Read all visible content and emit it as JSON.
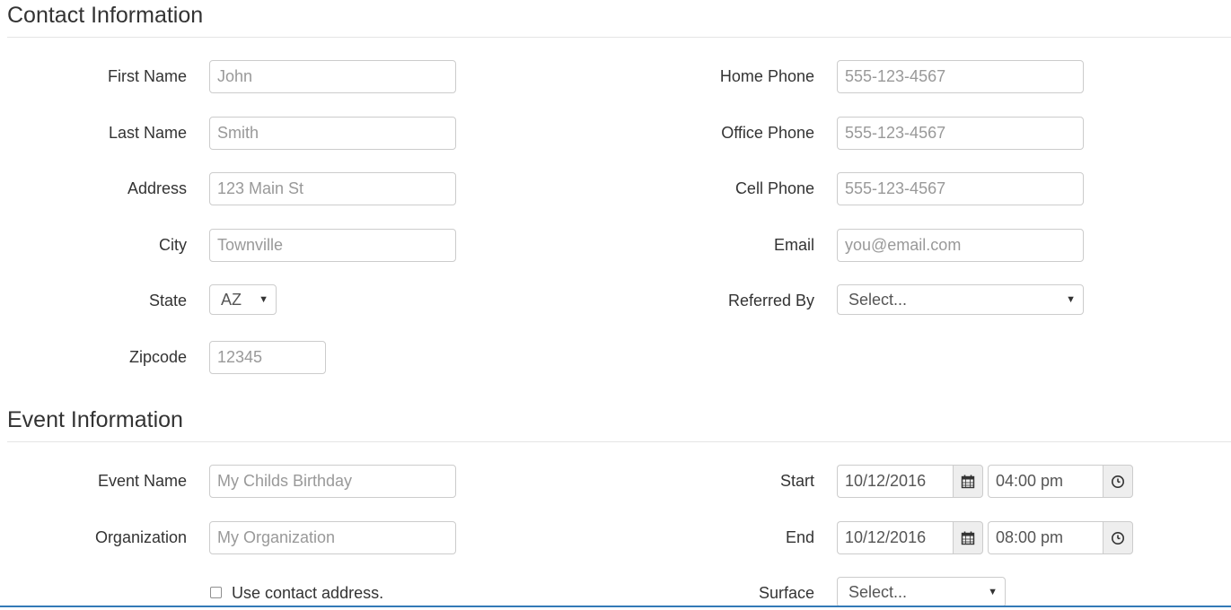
{
  "contact": {
    "title": "Contact Information",
    "first_name": {
      "label": "First Name",
      "placeholder": "John"
    },
    "last_name": {
      "label": "Last Name",
      "placeholder": "Smith"
    },
    "address": {
      "label": "Address",
      "placeholder": "123 Main St"
    },
    "city": {
      "label": "City",
      "placeholder": "Townville"
    },
    "state": {
      "label": "State",
      "value": "AZ"
    },
    "zipcode": {
      "label": "Zipcode",
      "placeholder": "12345"
    },
    "home_phone": {
      "label": "Home Phone",
      "placeholder": "555-123-4567"
    },
    "office_phone": {
      "label": "Office Phone",
      "placeholder": "555-123-4567"
    },
    "cell_phone": {
      "label": "Cell Phone",
      "placeholder": "555-123-4567"
    },
    "email": {
      "label": "Email",
      "placeholder": "you@email.com"
    },
    "referred_by": {
      "label": "Referred By",
      "value": "Select..."
    }
  },
  "event": {
    "title": "Event Information",
    "event_name": {
      "label": "Event Name",
      "placeholder": "My Childs Birthday"
    },
    "organization": {
      "label": "Organization",
      "placeholder": "My Organization"
    },
    "use_contact_address": {
      "label": "Use contact address.",
      "checked": false
    },
    "start": {
      "label": "Start",
      "date": "10/12/2016",
      "time": "04:00 pm"
    },
    "end": {
      "label": "End",
      "date": "10/12/2016",
      "time": "08:00 pm"
    },
    "surface": {
      "label": "Surface",
      "value": "Select..."
    }
  },
  "icons": {
    "calendar": "calendar-icon",
    "clock": "clock-icon",
    "caret": "caret-down-icon"
  },
  "colors": {
    "border": "#cccccc",
    "addon_bg": "#eeeeee",
    "accent": "#337ab7"
  }
}
